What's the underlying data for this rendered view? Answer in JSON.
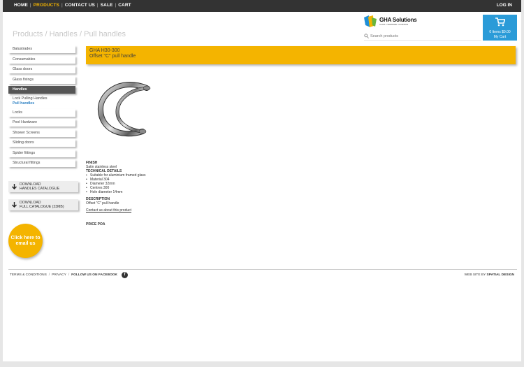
{
  "nav": {
    "items": [
      {
        "label": "HOME"
      },
      {
        "label": "PRODUCTS"
      },
      {
        "label": "CONTACT US"
      },
      {
        "label": "SALE"
      },
      {
        "label": "CART"
      }
    ],
    "separator": "|",
    "login": "LOG IN",
    "active_color": "#f4b400"
  },
  "breadcrumb": "Products / Handles / Pull handles",
  "logo": {
    "title": "GHA Solutions",
    "subtitle": "GLASS • HARDWARE • ALUMINIUM"
  },
  "search": {
    "placeholder": "Search products"
  },
  "cart": {
    "info": "0 Items $0.00",
    "label": "My Cart",
    "color": "#2a9bd8"
  },
  "sidebar": {
    "items": [
      {
        "label": "Balustrades"
      },
      {
        "label": "Consumables"
      },
      {
        "label": "Glass doors"
      },
      {
        "label": "Glass fixings"
      },
      {
        "label": "Handles"
      },
      {
        "label": "Locks"
      },
      {
        "label": "Pool Hardware"
      },
      {
        "label": "Shower Screens"
      },
      {
        "label": "Sliding doors"
      },
      {
        "label": "Spider fittings"
      },
      {
        "label": "Structural fittings"
      }
    ],
    "subitems": [
      {
        "label": "Lock Pulling Handles"
      },
      {
        "label": "Pull handles"
      }
    ]
  },
  "downloads": [
    {
      "line1": "DOWNLOAD",
      "line2": "HANDLES CATALOGUE"
    },
    {
      "line1": "DOWNLOAD",
      "line2": "FULL CATALOGUE (23MB)"
    }
  ],
  "email_cta": {
    "line1": "Click here to",
    "line2": "email us",
    "color": "#f4b400"
  },
  "product": {
    "code": "GHA H30-300",
    "name": "Offset \"C\" pull handle",
    "finish_heading": "FINISH",
    "finish": "Satin stainless steel",
    "tech_heading": "TECHNICAL DETAILS",
    "tech": [
      "Suitable for aluminium framed glass",
      "Material 304",
      "Diameter 32mm",
      "Centres 300",
      "Hole diameter 14mm"
    ],
    "desc_heading": "DESCRIPTION",
    "description": "Offset \"C\" pull handle",
    "contact_link": "Contact us about this product",
    "price": "PRICE POA"
  },
  "footer": {
    "terms": "TERMS & CONDITIONS",
    "privacy": "PRIVACY",
    "facebook": "FOLLOW US ON FACEBOOK",
    "fb_glyph": "f",
    "sep": "/",
    "credit_prefix": "WEB SITE BY",
    "credit_name": "SPATIAL DESIGN"
  }
}
